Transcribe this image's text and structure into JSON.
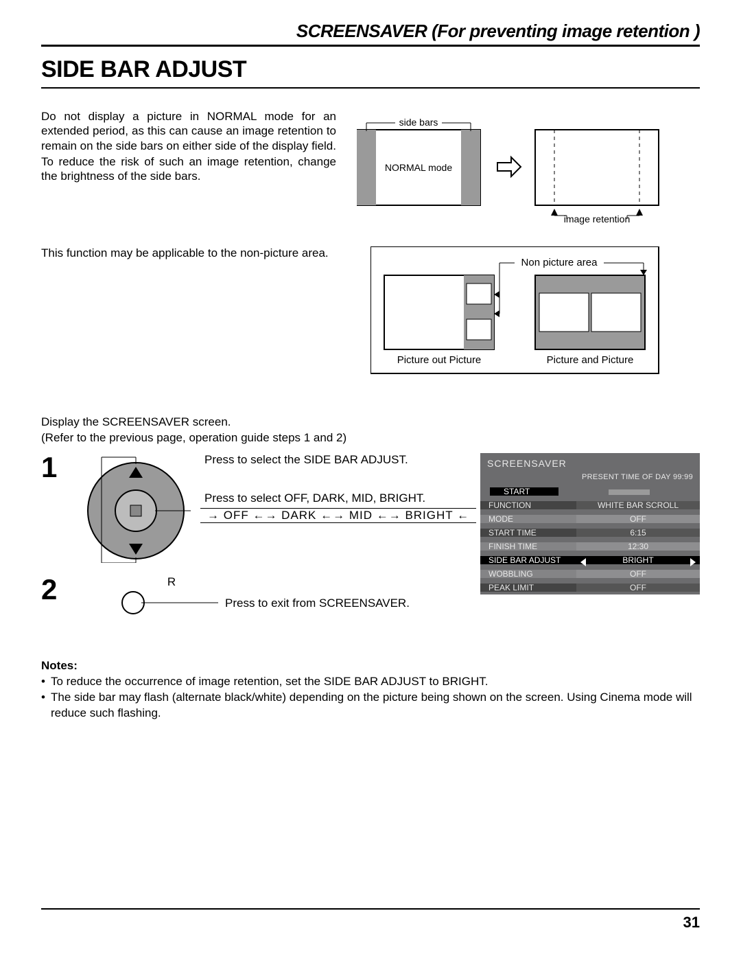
{
  "header": {
    "title": "SCREENSAVER (For preventing image retention )"
  },
  "title": "SIDE BAR ADJUST",
  "intro": {
    "p1": "Do not display a picture in NORMAL mode for an extended period, as this can cause an image retention to remain on the side bars on either side of the display field.",
    "p2": "To reduce the risk of such an image retention, change the brightness of the side bars."
  },
  "diag1": {
    "side_bars": "side bars",
    "normal_mode": "NORMAL mode",
    "image_retention": "image retention"
  },
  "row2": {
    "text": "This function may be applicable to the non-picture area.",
    "diag": {
      "non_picture_area": "Non picture area",
      "pop": "Picture out Picture",
      "pap": "Picture and Picture"
    }
  },
  "precede": {
    "l1": "Display the SCREENSAVER screen.",
    "l2": "(Refer to the previous page, operation guide steps 1 and 2)"
  },
  "step1": {
    "num": "1",
    "a": "Press to select the SIDE BAR ADJUST.",
    "b": "Press to select OFF, DARK, MID, BRIGHT.",
    "seq": "→ OFF ←→ DARK ←→ MID ←→ BRIGHT ←"
  },
  "step2": {
    "num": "2",
    "r": "R",
    "a": "Press to exit from SCREENSAVER."
  },
  "osd": {
    "title": "SCREENSAVER",
    "present": "PRESENT  TIME OF DAY     99:99",
    "rows": [
      {
        "label": "START",
        "value": ""
      },
      {
        "label": "FUNCTION",
        "value": "WHITE BAR SCROLL"
      },
      {
        "label": "MODE",
        "value": "OFF"
      },
      {
        "label": "START TIME",
        "value": "6:15"
      },
      {
        "label": "FINISH TIME",
        "value": "12:30"
      },
      {
        "label": "SIDE BAR ADJUST",
        "value": "BRIGHT"
      },
      {
        "label": "WOBBLING",
        "value": "OFF"
      },
      {
        "label": "PEAK LIMIT",
        "value": "OFF"
      }
    ]
  },
  "notes": {
    "heading": "Notes:",
    "n1": "To reduce the occurrence of image retention, set the SIDE BAR ADJUST to BRIGHT.",
    "n2": "The side bar may flash (alternate black/white) depending on the picture being shown on the screen. Using Cinema mode will reduce such flashing."
  },
  "page_number": "31"
}
